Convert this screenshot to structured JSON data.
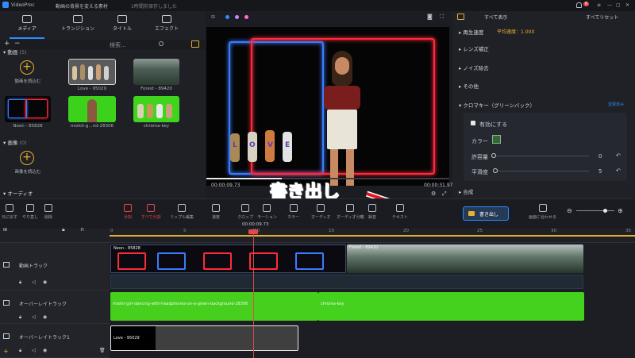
{
  "titlebar": {
    "app": "VideoProc",
    "project": "動画の背景を変える素材",
    "autosave": "1時間前保存しました",
    "notif_count": "6"
  },
  "media_tabs": [
    {
      "label": "メディア"
    },
    {
      "label": "トランジション"
    },
    {
      "label": "タイトル"
    },
    {
      "label": "エフェクト"
    }
  ],
  "media": {
    "search_placeholder": "検索...",
    "video_section": "動画",
    "video_count": "(5)",
    "import_video": "動画を読込む",
    "items": [
      {
        "label": "Love - 95029"
      },
      {
        "label": "Forest - 89420"
      },
      {
        "label": "Neon - 85828"
      },
      {
        "label": "mixkit-g...nd-28306"
      },
      {
        "label": "chroma-key"
      }
    ],
    "image_section": "画像",
    "image_count": "(0)",
    "import_image": "画像を読込む",
    "audio_section": "オーディオ"
  },
  "preview": {
    "time_current": "00:00:09.73",
    "time_total": "00:00:31.97",
    "letters": [
      "L",
      "O",
      "V",
      "E"
    ]
  },
  "right_panel": {
    "show_all": "すべて表示",
    "reset_all": "すべてリセット",
    "speed_label": "再生速度",
    "speed_value": "平均速度：1.00X",
    "lens": "レンズ補正",
    "noise": "ノイズ除去",
    "other": "その他",
    "chromakey": "クロマキー（グリーンバック）",
    "chromakey_action": "変更済み",
    "enable": "有効にする",
    "color": "カラー",
    "tolerance": "許容量",
    "tolerance_value": "0",
    "smooth": "平滑度",
    "smooth_value": "5",
    "composite": "合成",
    "export_button": "書き出し"
  },
  "annotation": {
    "text": "書き出し"
  },
  "toolbar": {
    "undo": "元に戻す",
    "redo": "やり直し",
    "delete": "削除",
    "split": "分割",
    "split_all": "すべて分割",
    "ripple": "リップル編集",
    "speed": "速度",
    "crop": "クロップ",
    "motion": "モーション",
    "color": "カラー",
    "audio": "オーディオ",
    "audio_extract": "オーディオ分離",
    "record": "録音",
    "text": "テキスト",
    "fit": "画面に合わせる"
  },
  "timeline": {
    "playhead": "00:00:09.73",
    "ruler": [
      "0",
      "5",
      "10",
      "15",
      "20",
      "25",
      "30",
      "35"
    ],
    "tracks": [
      {
        "name": "動画トラック",
        "clips": [
          {
            "label": "Neon - 85828"
          },
          {
            "label": "Forest - 89420"
          }
        ]
      },
      {
        "name": "オーバーレイトラック",
        "clips": [
          {
            "label": "mixkit-girl-dancing-with-headphones-on-a-green-background-28306"
          },
          {
            "label": "chroma-key"
          }
        ]
      },
      {
        "name": "オーバーレイトラック1",
        "clips": [
          {
            "label": "Love - 95029"
          }
        ]
      }
    ]
  },
  "colors": {
    "accent": "#2f8cff",
    "highlight": "#e0171f",
    "neon_blue": "#2a6bff",
    "neon_red": "#ff2a3a",
    "green_screen": "#3fd11f"
  }
}
